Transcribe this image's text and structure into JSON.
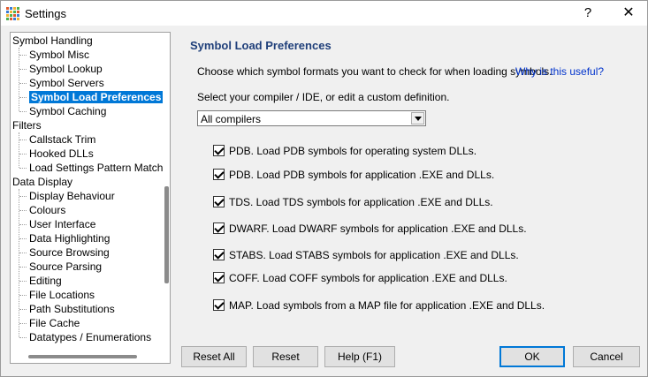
{
  "window": {
    "title": "Settings",
    "help_label": "?",
    "close_label": "✕"
  },
  "tree": {
    "items": [
      {
        "label": "Symbol Handling",
        "level": 0
      },
      {
        "label": "Symbol Misc",
        "level": 1
      },
      {
        "label": "Symbol Lookup",
        "level": 1
      },
      {
        "label": "Symbol Servers",
        "level": 1
      },
      {
        "label": "Symbol Load Preferences",
        "level": 1,
        "selected": true
      },
      {
        "label": "Symbol Caching",
        "level": 1
      },
      {
        "label": "Filters",
        "level": 0
      },
      {
        "label": "Callstack Trim",
        "level": 1
      },
      {
        "label": "Hooked DLLs",
        "level": 1
      },
      {
        "label": "Load Settings Pattern Match",
        "level": 1
      },
      {
        "label": "Data Display",
        "level": 0
      },
      {
        "label": "Display Behaviour",
        "level": 1
      },
      {
        "label": "Colours",
        "level": 1
      },
      {
        "label": "User Interface",
        "level": 1
      },
      {
        "label": "Data Highlighting",
        "level": 1
      },
      {
        "label": "Source Browsing",
        "level": 1
      },
      {
        "label": "Source Parsing",
        "level": 1
      },
      {
        "label": "Editing",
        "level": 1
      },
      {
        "label": "File Locations",
        "level": 1
      },
      {
        "label": "Path Substitutions",
        "level": 1
      },
      {
        "label": "File Cache",
        "level": 1
      },
      {
        "label": "Datatypes / Enumerations",
        "level": 1
      }
    ]
  },
  "panel": {
    "title": "Symbol Load Preferences",
    "description": "Choose which symbol formats you want to check for when loading symbols.",
    "link": "Why is this useful?",
    "select_label": "Select your compiler / IDE, or edit a custom definition.",
    "select_value": "All compilers",
    "options": [
      {
        "label": "PDB. Load PDB symbols for operating system DLLs.",
        "checked": true
      },
      {
        "label": "PDB. Load PDB symbols for application .EXE and DLLs.",
        "checked": true
      },
      {
        "label": "TDS. Load TDS symbols for application .EXE and DLLs.",
        "checked": true
      },
      {
        "label": "DWARF. Load DWARF symbols for application .EXE and DLLs.",
        "checked": true
      },
      {
        "label": "STABS. Load STABS symbols for application .EXE and DLLs.",
        "checked": true
      },
      {
        "label": "COFF. Load COFF symbols for application .EXE and DLLs.",
        "checked": true
      },
      {
        "label": "MAP. Load symbols from a MAP file for application .EXE and DLLs.",
        "checked": true
      }
    ]
  },
  "buttons": {
    "reset_all": "Reset All",
    "reset": "Reset",
    "help": "Help (F1)",
    "ok": "OK",
    "cancel": "Cancel"
  },
  "colors": {
    "selection": "#0078d7",
    "section_title": "#1f3f7a",
    "link": "#0033cc"
  }
}
